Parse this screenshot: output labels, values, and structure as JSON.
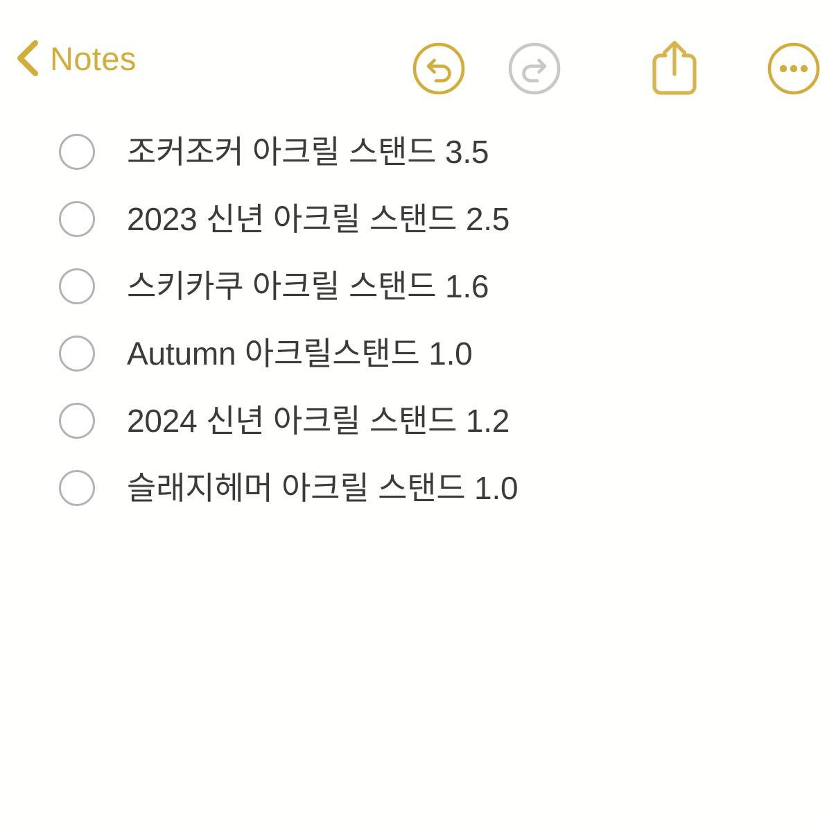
{
  "app": {
    "name": "Notes",
    "background_color": "#fffffe",
    "accent_color": "#d3ad3c",
    "disabled_color": "#c8c8c8",
    "text_color": "#3b3b3b",
    "checkbox_color": "#b3b3b3"
  },
  "navbar": {
    "back": {
      "icon": "chevron-left-icon",
      "label": "Notes"
    },
    "actions": [
      {
        "icon": "undo-icon",
        "name": "undo",
        "state": "enabled",
        "color": "#d3ad3c"
      },
      {
        "icon": "redo-icon",
        "name": "redo",
        "state": "disabled",
        "color": "#c8c8c8"
      },
      {
        "icon": "share-icon",
        "name": "share",
        "state": "enabled",
        "color": "#d9b44c"
      },
      {
        "icon": "more-icon",
        "name": "more",
        "state": "enabled",
        "color": "#d3ad3c"
      }
    ]
  },
  "checklist": {
    "items": [
      {
        "checked": false,
        "text": "조커조커 아크릴 스탠드 3.5"
      },
      {
        "checked": false,
        "text": "2023 신년 아크릴 스탠드 2.5"
      },
      {
        "checked": false,
        "text": "스키카쿠 아크릴 스탠드 1.6"
      },
      {
        "checked": false,
        "text": "Autumn 아크릴스탠드 1.0"
      },
      {
        "checked": false,
        "text": "2024 신년 아크릴 스탠드 1.2"
      },
      {
        "checked": false,
        "text": "슬래지헤머 아크릴 스탠드 1.0"
      }
    ]
  }
}
